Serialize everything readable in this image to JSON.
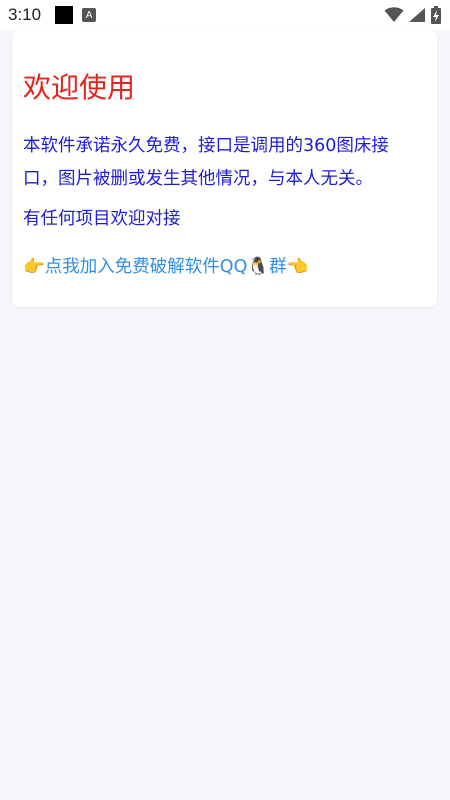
{
  "status_bar": {
    "time": "3:10",
    "notification_a": "A"
  },
  "card": {
    "title": "欢迎使用",
    "description": "本软件承诺永久免费，接口是调用的360图床接口，图片被删或发生其他情况，与本人无关。",
    "contact": "有任何项目欢迎对接",
    "link_text": "👉点我加入免费破解软件QQ🐧群👈"
  },
  "colors": {
    "title": "#e5231d",
    "body_text": "#1d1dd6",
    "link": "#2f8fe8",
    "background": "#f5f6fa"
  },
  "icons": [
    "wifi-icon",
    "signal-icon",
    "battery-charging-icon"
  ]
}
